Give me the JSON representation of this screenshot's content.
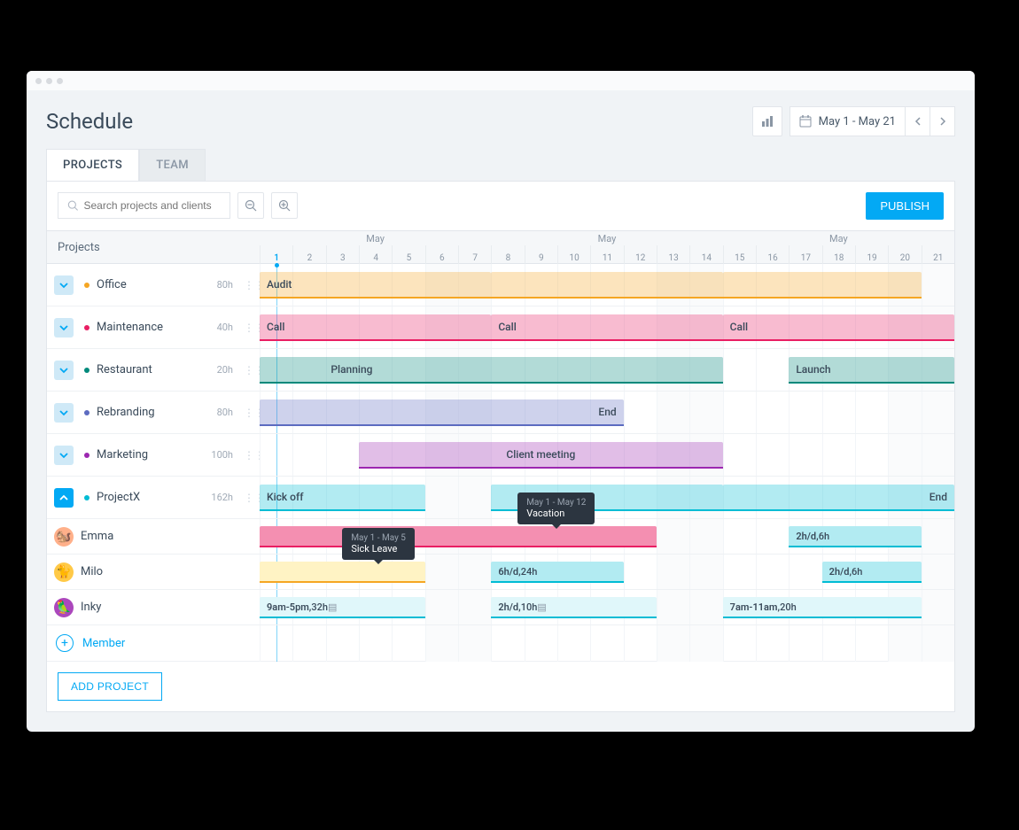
{
  "page_title": "Schedule",
  "date_range": "May 1 - May 21",
  "tabs": {
    "projects": "PROJECTS",
    "team": "TEAM"
  },
  "search_placeholder": "Search projects and clients",
  "publish_label": "PUBLISH",
  "projects_header": "Projects",
  "month_label": "May",
  "days": [
    1,
    2,
    3,
    4,
    5,
    6,
    7,
    8,
    9,
    10,
    11,
    12,
    13,
    14,
    15,
    16,
    17,
    18,
    19,
    20,
    21
  ],
  "today": 1,
  "projects": [
    {
      "name": "Office",
      "hours": "80h",
      "color": "#f5a623",
      "bars": [
        {
          "label": "Audit",
          "segments": [
            [
              1,
              7
            ],
            [
              8,
              14
            ],
            [
              15,
              20
            ]
          ]
        }
      ]
    },
    {
      "name": "Maintenance",
      "hours": "40h",
      "color": "#e91e63",
      "bars": [
        {
          "label": "Call",
          "start": 1,
          "span": 7
        },
        {
          "label": "Call",
          "start": 8,
          "span": 7
        },
        {
          "label": "Call",
          "start": 15,
          "span": 7
        }
      ]
    },
    {
      "name": "Restaurant",
      "hours": "20h",
      "color": "#00897b",
      "bars": [
        {
          "label": "Planning",
          "start": 1,
          "span": 14,
          "labelOffset": 2
        },
        {
          "label": "Launch",
          "start": 17,
          "span": 5
        }
      ]
    },
    {
      "name": "Rebranding",
      "hours": "80h",
      "color": "#5c6bc0",
      "bars": [
        {
          "label": "End",
          "start": 1,
          "span": 11,
          "labelAlign": "right"
        }
      ]
    },
    {
      "name": "Marketing",
      "hours": "100h",
      "color": "#9c27b0",
      "bars": [
        {
          "label": "Client meeting",
          "start": 4,
          "span": 11,
          "labelAlign": "center"
        }
      ]
    },
    {
      "name": "ProjectX",
      "hours": "162h",
      "color": "#00bcd4",
      "expanded": true,
      "bars": [
        {
          "label": "Kick off",
          "start": 1,
          "end": 5
        },
        {
          "label": "",
          "start": 8,
          "end": 14
        },
        {
          "label": "End",
          "start": 15,
          "end": 21,
          "labelAlign": "right"
        }
      ]
    }
  ],
  "members": [
    {
      "name": "Emma",
      "avatar_bg": "#ffb08a",
      "bars": [
        {
          "start": 1,
          "end": 12,
          "label": "",
          "type": "vacation",
          "color": "#f48fb1"
        },
        {
          "start": 17,
          "end": 20,
          "label_bold": "2h/d,",
          "label_rest": " 6h",
          "color": "#b2ebf2"
        }
      ]
    },
    {
      "name": "Milo",
      "avatar_bg": "#ffc947",
      "bars": [
        {
          "start": 1,
          "end": 5,
          "label": "",
          "type": "sick",
          "color": "#fff3c4"
        },
        {
          "start": 8,
          "end": 11,
          "label_bold": "6h/d,",
          "label_rest": " 24h",
          "color": "#b2ebf2"
        },
        {
          "start": 18,
          "end": 20,
          "label_bold": "2h/d,",
          "label_rest": " 6h",
          "color": "#b2ebf2"
        }
      ]
    },
    {
      "name": "Inky",
      "avatar_bg": "#ab47bc",
      "bars": [
        {
          "start": 1,
          "end": 5,
          "label_bold": "9am-5pm,",
          "label_rest": " 32h",
          "color": "#e0f7fa",
          "icon": true
        },
        {
          "start": 8,
          "end": 12,
          "label_bold": "2h/d,",
          "label_rest": " 10h",
          "color": "#e0f7fa",
          "icon": true
        },
        {
          "start": 15,
          "end": 20,
          "label_bold": "7am-11am,",
          "label_rest": " 20h",
          "color": "#e0f7fa"
        }
      ]
    }
  ],
  "tooltips": {
    "vacation": {
      "date": "May 1 - May 12",
      "text": "Vacation"
    },
    "sick": {
      "date": "May 1 - May 5",
      "text": "Sick Leave"
    }
  },
  "add_member_label": "Member",
  "add_project_label": "ADD PROJECT"
}
